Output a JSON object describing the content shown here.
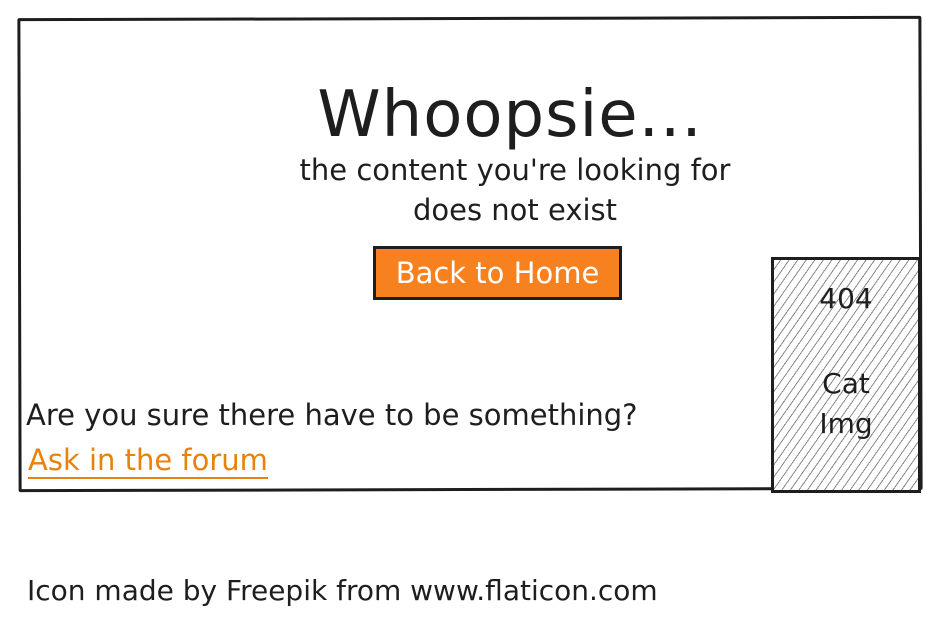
{
  "error_page": {
    "title": "Whoopsie...",
    "subtitle_line1": "the content you're looking for",
    "subtitle_line2": "does not exist",
    "home_button_label": "Back to Home",
    "question": "Are you sure there have to be something?",
    "forum_link_label": "Ask in the forum"
  },
  "cat_image": {
    "code": "404",
    "label_line1": "Cat",
    "label_line2": "Img"
  },
  "footer": {
    "credit": "Icon made by Freepik from www.flaticon.com"
  },
  "colors": {
    "accent": "#f7801f",
    "link": "#e8820c",
    "ink": "#1e1e1e"
  }
}
